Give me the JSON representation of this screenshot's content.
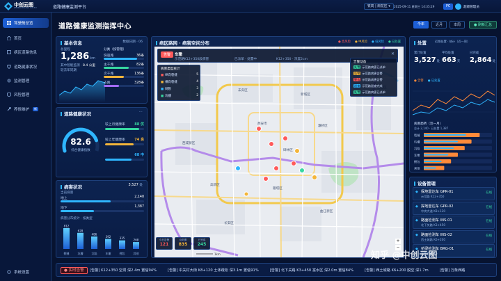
{
  "topbar": {
    "logo": "中创云图",
    "logo_sub": "ZHONG CHUANG YUN TU",
    "system_title": "道路健康监测平台",
    "region": "铁岗 | 雨花区",
    "datetime": "2025-09-11 星期三 14:35:29",
    "pc_label": "PC",
    "user": "超级管理员"
  },
  "nav": {
    "items": [
      {
        "label": "驾驶舱总览",
        "badge": ""
      },
      {
        "label": "首页",
        "badge": ""
      },
      {
        "label": "病区道路信息",
        "badge": ""
      },
      {
        "label": "道路健康状况",
        "badge": ""
      },
      {
        "label": "监测管理",
        "badge": ""
      },
      {
        "label": "风险管理",
        "badge": ""
      },
      {
        "label": "养修维护",
        "badge": "新"
      }
    ],
    "footer": "系统设置"
  },
  "header": {
    "title": "道路健康监测指挥中心",
    "tabs": [
      "今年",
      "近月",
      "本周"
    ],
    "refresh": "刷新汇总"
  },
  "basic": {
    "title": "基本信息",
    "meta": "数据日期 · 06",
    "total_label": "总里程",
    "total_value": "1,286",
    "total_unit": "km",
    "sub1": "其中智能监测 ·",
    "sub1_val": "8.4 公里",
    "sub2": "较去年同期",
    "cat_title": "分类（按管理）",
    "cats": [
      {
        "label": "快速路",
        "value": "36条",
        "pct": 0.82,
        "color": "#2fb6ff"
      },
      {
        "label": "主干路",
        "value": "82条",
        "pct": 0.62,
        "color": "#37d7a0"
      },
      {
        "label": "次干路",
        "value": "136条",
        "pct": 0.5,
        "color": "#f3b53a"
      },
      {
        "label": "支路",
        "value": "328条",
        "pct": 0.38,
        "color": "#a36bff"
      }
    ]
  },
  "health": {
    "title": "道路健康状况",
    "score": "82.6",
    "score_label": "综合健康指数",
    "items": [
      {
        "label": "较上月健康率",
        "value": "88 优",
        "pct": 0.88,
        "color": "#37d7a0"
      },
      {
        "label": "较上年健康率",
        "value": "74 良",
        "pct": 0.74,
        "color": "#f3b53a"
      },
      {
        "label": "",
        "value": "68 中",
        "pct": 0.68,
        "color": "#2fb6ff"
      }
    ]
  },
  "disease": {
    "title": "病害状况",
    "count": "3,527",
    "count_sub": "处",
    "head": "当前病害",
    "rows": [
      {
        "label": "地上",
        "value": "2,140",
        "pct": 0.6
      },
      {
        "label": "地下",
        "value": "1,387",
        "pct": 0.4
      }
    ],
    "cat_title": "病害分布统计 · 按类型",
    "bars": [
      {
        "label": "裂缝",
        "value": "812"
      },
      {
        "label": "坑槽",
        "value": "628"
      },
      {
        "label": "沉陷",
        "value": "486"
      },
      {
        "label": "车辙",
        "value": "392"
      },
      {
        "label": "拥包",
        "value": "335"
      },
      {
        "label": "其他",
        "value": "268"
      }
    ]
  },
  "map": {
    "title": "病区路网 · 病害空间分布",
    "legend": [
      "● 高风险",
      "● 中风险",
      "● 低风险",
      "● 已处置"
    ],
    "popup": {
      "tag": "告警",
      "title": "车辙",
      "line1": "示范路K12+350段病害",
      "line2": "已派单 · 处置中",
      "line3": "K12+350 · 深度2cm"
    },
    "left_title": "病害类型统计",
    "left_rows": [
      {
        "label": "纵向裂缝",
        "value": "5"
      },
      {
        "label": "横向裂缝",
        "value": "4"
      },
      {
        "label": "网裂",
        "value": "3"
      },
      {
        "label": "坑槽",
        "value": "2"
      }
    ],
    "right_title": "告警动态",
    "right_rows": [
      {
        "tag": "处置",
        "text": "示范路病害已派单",
        "cls": "#37d7a0"
      },
      {
        "tag": "告警",
        "text": "示范路病害告警",
        "cls": "#f3b53a"
      },
      {
        "tag": "警告",
        "text": "示范路病害告警",
        "cls": "#ff5a5a"
      },
      {
        "tag": "巡查",
        "text": "示范路巡查完成",
        "cls": "#2fb6ff"
      },
      {
        "tag": "处置",
        "text": "示范路病害已派单",
        "cls": "#37d7a0"
      }
    ],
    "stats": [
      {
        "label": "今日告警",
        "value": "121",
        "color": "#ff5a5a"
      },
      {
        "label": "待处置",
        "value": "835",
        "color": "#f3b53a"
      },
      {
        "label": "已完成",
        "value": "245",
        "color": "#37d7a0"
      }
    ],
    "areas": [
      "西安市",
      "未央区",
      "新城区",
      "碑林区",
      "雁塔区",
      "灞桥区",
      "长安区",
      "西咸新区",
      "曲江新区",
      "高新区",
      "临潼区"
    ],
    "scale": "1km"
  },
  "right": {
    "title": "处置",
    "sub": "近期处置 · 统计（近一周）",
    "kpis": [
      {
        "label": "累计处置",
        "value": "3,527",
        "unit": "处"
      },
      {
        "label": "平均处置",
        "value": "663",
        "unit": "天"
      },
      {
        "label": "已完成",
        "value": "2,864",
        "unit": "处"
      }
    ],
    "legend": [
      "告警",
      "已处置"
    ],
    "line_title": "病害趋势（近一月）",
    "line_sub": "总计 2,140  ·  已处置 1,387",
    "hbars": [
      {
        "label": "裂缝",
        "a": 0.82,
        "b": 0.62
      },
      {
        "label": "坑槽",
        "a": 0.7,
        "b": 0.5
      },
      {
        "label": "沉陷",
        "a": 0.6,
        "b": 0.44
      },
      {
        "label": "车辙",
        "a": 0.5,
        "b": 0.36
      },
      {
        "label": "拥包",
        "a": 0.4,
        "b": 0.26
      },
      {
        "label": "其他",
        "a": 0.3,
        "b": 0.18
      }
    ]
  },
  "devices": {
    "title": "设备管理",
    "items": [
      {
        "name": "探地雷达车 GPR-01",
        "status": "在线",
        "sub": "示范路 K12+350"
      },
      {
        "name": "探地雷达车 GPR-02",
        "status": "在线",
        "sub": "中央大道 K8+120"
      },
      {
        "name": "路面检测车 INS-01",
        "status": "在线",
        "sub": "北下关路 K3+450"
      },
      {
        "name": "路面检测车 INS-02",
        "status": "在线",
        "sub": "西土城路 K6+200"
      },
      {
        "name": "桥梁检测车 BRG-01",
        "status": "在线",
        "sub": "万象西路 K6"
      }
    ]
  },
  "ticker": {
    "label": "实时告警",
    "items": [
      "[告警] K12+350 空洞 深2.4m 置信94%",
      "[告警] 中关村大街 K8+120 土体疏松 深3.1m 置信91%",
      "[告警] 北下关路 K3+450 富水区 深2.0m 置信84%",
      "[告警] 西土城路 K6+200 脱空 深1.7m",
      "[告警] 万象西路"
    ]
  },
  "watermark": "知乎 @中创云图",
  "colors": {
    "bg": "#071330",
    "panel": "#0c2350",
    "accent": "#2fb6ff",
    "green": "#37d7a0",
    "amber": "#f3b53a",
    "red": "#ff5a5a",
    "purple": "#a36bff"
  }
}
